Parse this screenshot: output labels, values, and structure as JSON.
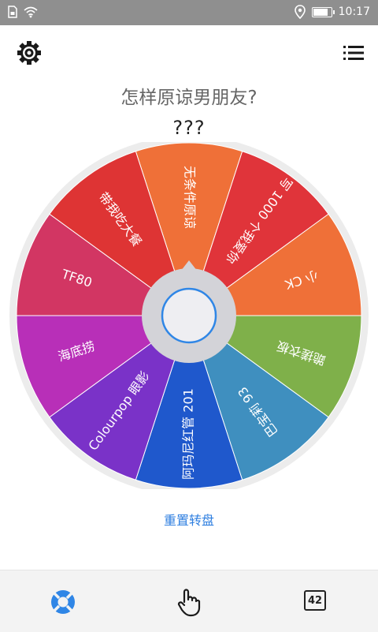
{
  "status_bar": {
    "time": "10:17",
    "icons": [
      "sim-icon",
      "wifi-icon",
      "location-icon",
      "battery-icon"
    ],
    "battery_level": 0.85
  },
  "header": {
    "settings_icon": "gear-icon",
    "menu_icon": "list-icon"
  },
  "question": {
    "title": "怎样原谅男朋友?",
    "result": "???"
  },
  "wheel": {
    "colors": {
      "hub": "#d3d3d8",
      "hub_inner": "#eeeef2",
      "hub_ring": "#2f86e6",
      "rim": "#ececec"
    },
    "segments": [
      {
        "label": "无条件原谅",
        "color": "#ef7038"
      },
      {
        "label": "写 1000 个我爱你",
        "color": "#e0343a"
      },
      {
        "label": "小 CK",
        "color": "#ef7038"
      },
      {
        "label": "跪搓衣板",
        "color": "#7fb04a"
      },
      {
        "label": "巴宝莉 93",
        "color": "#3f8fbf"
      },
      {
        "label": "阿玛尼红管 201",
        "color": "#1f58cc"
      },
      {
        "label": "Colourpop 眼影",
        "color": "#7a32c8"
      },
      {
        "label": "海底捞",
        "color": "#b82fb8"
      },
      {
        "label": "TF80",
        "color": "#d23663"
      },
      {
        "label": "带我吃大餐",
        "color": "#de3434"
      }
    ]
  },
  "actions": {
    "reset_label": "重置转盘"
  },
  "bottom_nav": {
    "items": [
      {
        "name": "wheel",
        "icon": "lifebuoy-icon",
        "active": true
      },
      {
        "name": "tap",
        "icon": "hand-pointer-icon",
        "active": false
      },
      {
        "name": "number",
        "icon": "number-box-icon",
        "label": "42",
        "active": false
      }
    ]
  }
}
